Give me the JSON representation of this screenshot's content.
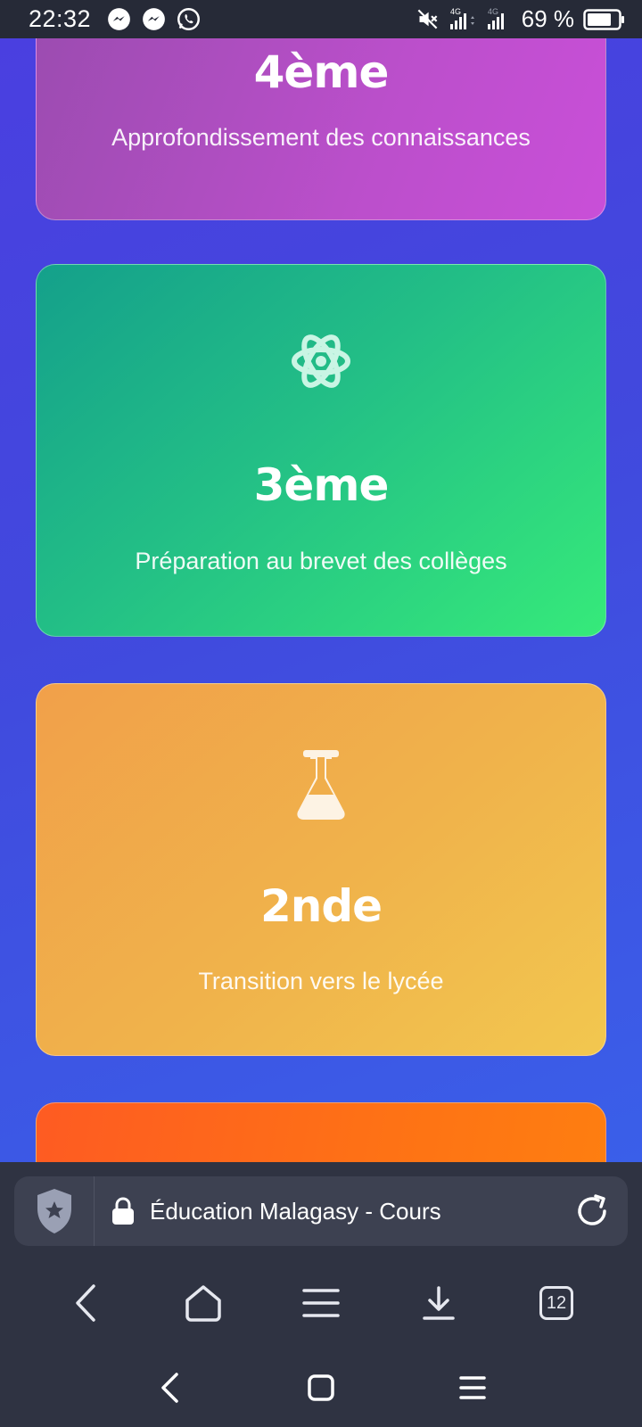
{
  "status_bar": {
    "time": "22:32",
    "battery_percent": "69 %",
    "network_1": "4G",
    "network_2": "4G",
    "notification_icons": [
      "messenger-icon",
      "messenger-icon",
      "whatsapp-icon"
    ],
    "system_icons": [
      "mute-icon",
      "signal-icon",
      "signal-icon",
      "battery-icon"
    ]
  },
  "cards": [
    {
      "title": "4ème",
      "description": "Approfondissement des connaissances",
      "icon": null
    },
    {
      "title": "3ème",
      "description": "Préparation au brevet des collèges",
      "icon": "atom-icon"
    },
    {
      "title": "2nde",
      "description": "Transition vers le lycée",
      "icon": "flask-icon"
    }
  ],
  "address_bar": {
    "url_title": "Éducation Malagasy - Cours"
  },
  "toolbar": {
    "tab_count": "12",
    "icons": [
      "back-icon",
      "home-icon",
      "menu-icon",
      "download-icon",
      "tabs-icon"
    ]
  },
  "colors": {
    "page_bg": "#4149dd",
    "card_4": "#bb4fcb",
    "card_3": "#23bf86",
    "card_2": "#f0b34b",
    "card_next": "#fe7215",
    "chrome_bg": "#2f3342"
  }
}
